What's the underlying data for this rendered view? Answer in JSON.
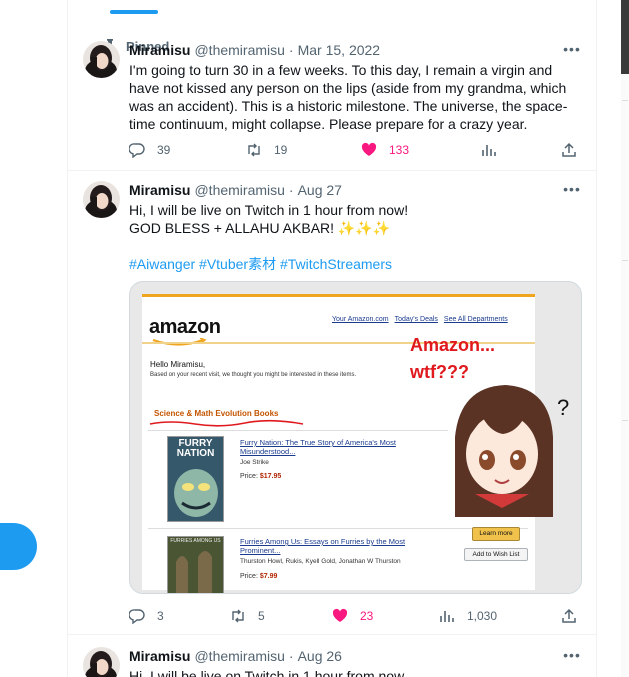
{
  "colors": {
    "accent": "#1d9bf0",
    "like": "#f91880",
    "muted": "#536471",
    "text": "#0f1419"
  },
  "pinned_label": "Pinned",
  "tweets": [
    {
      "name": "Miramisu",
      "handle": "@themiramisu",
      "date": "Mar 15, 2022",
      "text": "I'm going to turn 30 in a few weeks. To this day, I remain a virgin and have not kissed any person on the lips (aside from my grandma, which was an accident). This is a historic milestone. The universe, the space-time continuum, might collapse. Please prepare for a crazy year.",
      "replies": "39",
      "retweets": "19",
      "likes": "133",
      "liked": true
    },
    {
      "name": "Miramisu",
      "handle": "@themiramisu",
      "date": "Aug 27",
      "line1": "Hi, I will be live on Twitch in 1 hour from now!",
      "line2": "GOD BLESS + ALLAHU AKBAR! ✨✨✨",
      "hashtags": "#Aiwanger #Vtuber素材 #TwitchStreamers",
      "replies": "3",
      "retweets": "5",
      "likes": "23",
      "views": "1,030",
      "liked": true,
      "media": {
        "logo": "amazon",
        "links": [
          "Your Amazon.com",
          "Today's Deals",
          "See All Departments"
        ],
        "hello": "Hello Miramisu,",
        "based": "Based on your recent visit, we thought you might be interested in these items.",
        "category": "Science & Math Evolution Books",
        "books": [
          {
            "cover": "FURRY NATION",
            "title": "Furry Nation: The True Story of America's Most Misunderstood...",
            "author": "Joe Strike",
            "price_label": "Price:",
            "price": "$17.95"
          },
          {
            "cover": "FURRIES AMONG US",
            "title": "Furries Among Us: Essays on Furries by the Most Prominent...",
            "author": "Thurston Howl, Rukis, Kyell Gold, Jonathan W Thurston",
            "price_label": "Price:",
            "price": "$7.99"
          }
        ],
        "learn_more": "Learn more",
        "wish_list": "Add to Wish List",
        "annotation_1": "Amazon...",
        "annotation_2": "wtf???",
        "question": "?"
      }
    },
    {
      "name": "Miramisu",
      "handle": "@themiramisu",
      "date": "Aug 26",
      "text": "Hi, I will be live on Twitch in 1 hour from now"
    }
  ],
  "icons": [
    "pin-icon",
    "more-icon",
    "reply-icon",
    "retweet-icon",
    "heart-icon",
    "analytics-icon",
    "share-icon",
    "compose-fab"
  ]
}
